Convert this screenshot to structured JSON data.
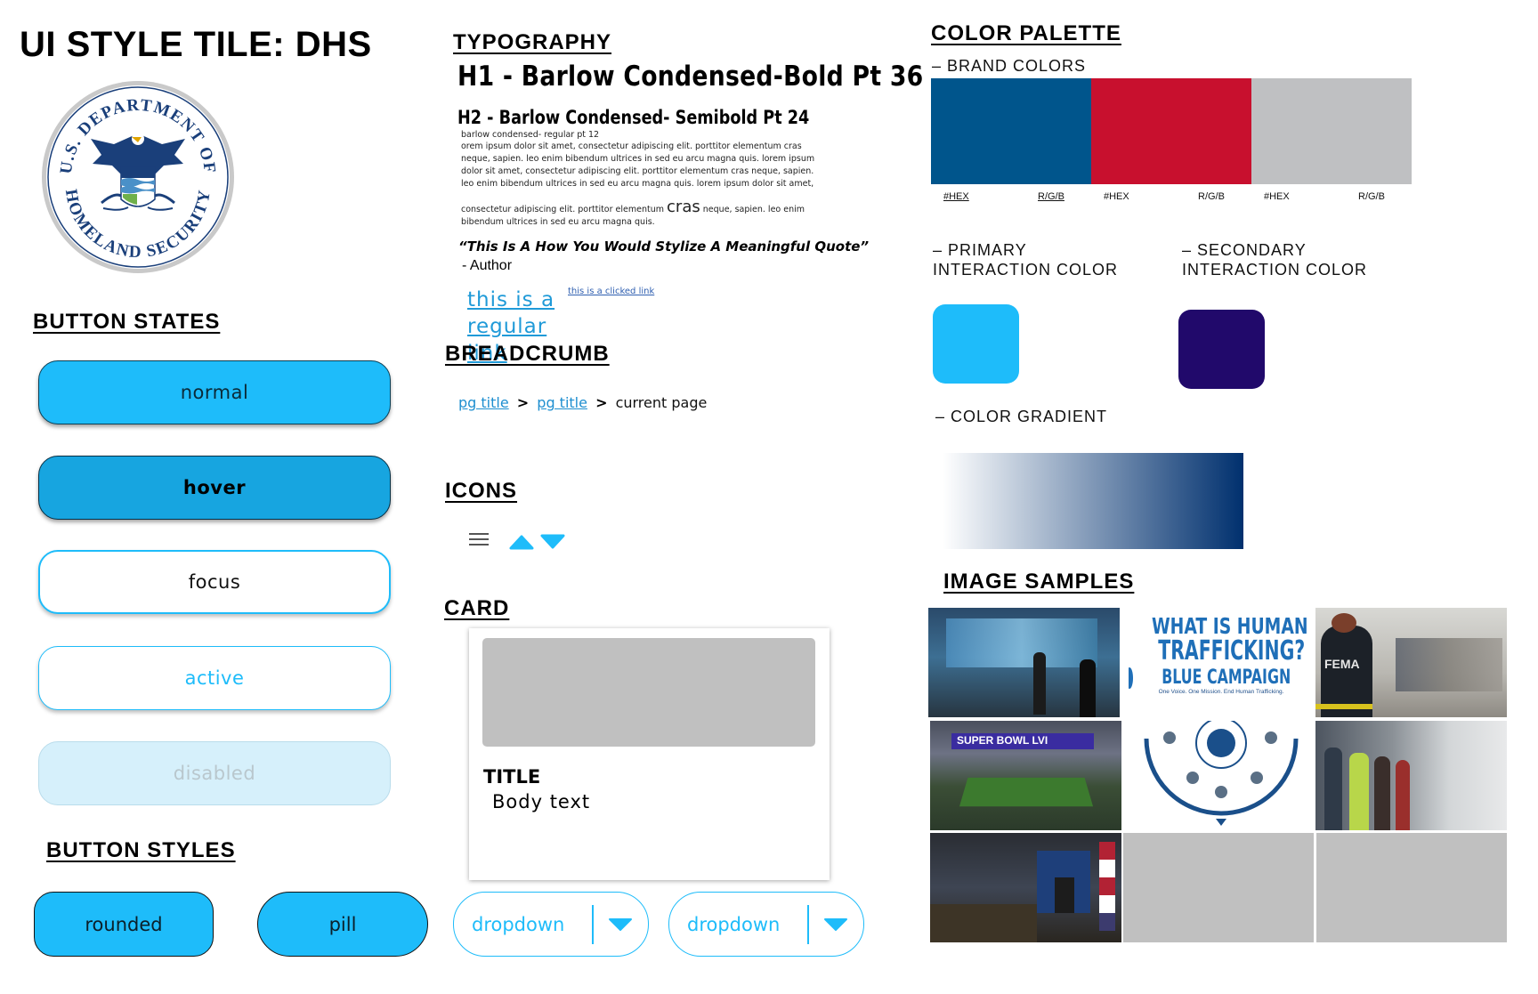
{
  "title": "UI STYLE TILE: DHS",
  "seal": {
    "top_text": "U.S. DEPARTMENT OF",
    "bottom_text": "HOMELAND SECURITY"
  },
  "sections": {
    "button_states": "BUTTON STATES",
    "button_styles": "BUTTON STYLES",
    "typography": "TYPOGRAPHY",
    "breadcrumb": "BREADCRUMB",
    "icons": "ICONS",
    "card": "CARD",
    "color_palette": "COLOR PALETTE",
    "image_samples": "IMAGE SAMPLES"
  },
  "button_states": {
    "normal": "normal",
    "hover": "hover",
    "focus": "focus",
    "active": "active",
    "disabled": "disabled"
  },
  "button_styles": {
    "rounded": "rounded",
    "pill": "pill",
    "dropdown1": "dropdown",
    "dropdown2": "dropdown"
  },
  "typography": {
    "h1": "H1 - Barlow Condensed-Bold Pt 36",
    "h2": "H2 - Barlow Condensed- Semibold Pt 24",
    "body_label": "barlow condensed- regular pt 12",
    "body_1": "orem ipsum dolor sit amet, consectetur adipiscing elit. porttitor elementum cras neque, sapien. leo enim bibendum ultrices in sed eu arcu magna quis. lorem ipsum dolor sit amet, consectetur adipiscing elit. porttitor elementum cras neque, sapien. leo enim bibendum ultrices in sed eu arcu magna quis. lorem ipsum dolor sit amet,",
    "body_2_pre": "consectetur adipiscing elit. porttitor elementum",
    "body_2_big": "cras",
    "body_2_post": "neque, sapien. leo enim bibendum ultrices in sed eu arcu magna quis.",
    "quote": "“This Is A How You Would Stylize A Meaningful Quote”",
    "author": "- Author",
    "regular_link": "this is a regular link",
    "clicked_link": "this is a clicked link"
  },
  "breadcrumb": {
    "item1": "pg title",
    "sep": ">",
    "item2": "pg title",
    "current": "current page"
  },
  "icons": [
    "hamburger-icon",
    "caret-up-icon",
    "caret-down-icon"
  ],
  "card": {
    "title": "TITLE",
    "body": "Body text"
  },
  "palette": {
    "brand_label": "– BRAND COLORS",
    "brand": [
      {
        "color": "#00558c",
        "hex": "#HEX",
        "rgb": "R/G/B"
      },
      {
        "color": "#c8102e",
        "hex": "#HEX",
        "rgb": "R/G/B"
      },
      {
        "color": "#bfc0c2",
        "hex": "#HEX",
        "rgb": "R/G/B"
      }
    ],
    "primary_label_1": "– PRIMARY",
    "primary_label_2": "INTERACTION COLOR",
    "primary_color": "#1ebcfa",
    "secondary_label_1": "– SECONDARY",
    "secondary_label_2": "INTERACTION COLOR",
    "secondary_color": "#21096b",
    "gradient_label": "– COLOR GRADIENT",
    "gradient_from": "#ffffff",
    "gradient_to": "#00306e"
  },
  "image_samples": {
    "trafficking_line1": "WHAT IS HUMAN",
    "trafficking_line2": "TRAFFICKING?",
    "trafficking_brand": "BLUE CAMPAIGN",
    "trafficking_tagline": "One Voice. One Mission. End Human Trafficking.",
    "superbowl": "SUPER BOWL LVI",
    "fema": "FEMA"
  }
}
